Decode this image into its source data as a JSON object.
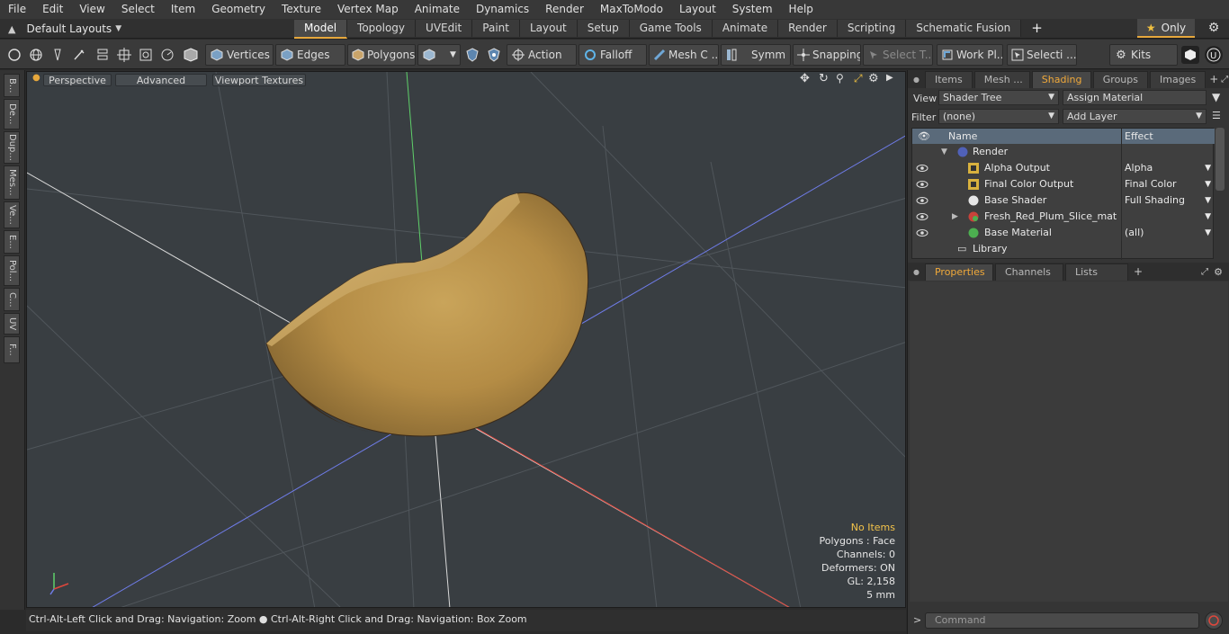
{
  "menu": [
    "File",
    "Edit",
    "View",
    "Select",
    "Item",
    "Geometry",
    "Texture",
    "Vertex Map",
    "Animate",
    "Dynamics",
    "Render",
    "MaxToModo",
    "Layout",
    "System",
    "Help"
  ],
  "layout": {
    "selector": "Default Layouts",
    "star_label": "Only"
  },
  "tabs": [
    {
      "label": "Model",
      "active": true
    },
    {
      "label": "Topology"
    },
    {
      "label": "UVEdit"
    },
    {
      "label": "Paint"
    },
    {
      "label": "Layout"
    },
    {
      "label": "Setup"
    },
    {
      "label": "Game Tools"
    },
    {
      "label": "Animate"
    },
    {
      "label": "Render"
    },
    {
      "label": "Scripting"
    },
    {
      "label": "Schematic Fusion"
    }
  ],
  "toolbar": {
    "vertices": "Vertices",
    "edges": "Edges",
    "polygons": "Polygons",
    "action": "Action",
    "falloff": "Falloff",
    "mesh": "Mesh C ...",
    "symmetry": "Symm ...",
    "snapping": "Snapping",
    "select_t": "Select T...",
    "workplane": "Work Pl...",
    "selection": "Selecti ...",
    "kits": "Kits"
  },
  "leftstrip": [
    "B...",
    "De...",
    "Dup...",
    "Mes...",
    "Ve...",
    "E...",
    "Pol...",
    "C...",
    "UV",
    "F..."
  ],
  "viewport": {
    "perspective": "Perspective",
    "advanced": "Advanced",
    "textures": "Viewport Textures",
    "info": {
      "selection": "No Items",
      "polygons": "Polygons : Face",
      "channels": "Channels: 0",
      "deformers": "Deformers: ON",
      "gl": "GL: 2,158",
      "unit": "5 mm"
    }
  },
  "status": "Ctrl-Alt-Left Click and Drag: Navigation: Zoom ● Ctrl-Alt-Right Click and Drag: Navigation: Box Zoom",
  "right": {
    "tabs": [
      {
        "label": "Items"
      },
      {
        "label": "Mesh ..."
      },
      {
        "label": "Shading",
        "active": true
      },
      {
        "label": "Groups"
      },
      {
        "label": "Images"
      }
    ],
    "view_label": "View",
    "view_value": "Shader Tree",
    "assign": "Assign Material",
    "filter_label": "Filter",
    "filter_value": "(none)",
    "add_layer": "Add Layer",
    "col_name": "Name",
    "col_effect": "Effect",
    "rows": [
      {
        "name": "Render",
        "effect": "",
        "indent": 0
      },
      {
        "name": "Alpha Output",
        "effect": "Alpha",
        "indent": 1
      },
      {
        "name": "Final Color Output",
        "effect": "Final Color",
        "indent": 1
      },
      {
        "name": "Base Shader",
        "effect": "Full Shading",
        "indent": 1
      },
      {
        "name": "Fresh_Red_Plum_Slice_mat",
        "effect": "",
        "indent": 1
      },
      {
        "name": "Base Material",
        "effect": "(all)",
        "indent": 1
      },
      {
        "name": "Library",
        "effect": "",
        "indent": 0
      }
    ],
    "lower_tabs": [
      {
        "label": "Properties",
        "active": true
      },
      {
        "label": "Channels"
      },
      {
        "label": "Lists"
      }
    ],
    "command_placeholder": "Command"
  },
  "colors": {
    "accent": "#e6a73c",
    "viewport_bg": "#393e42",
    "panel": "#353535"
  }
}
